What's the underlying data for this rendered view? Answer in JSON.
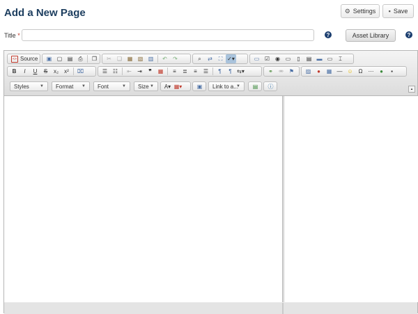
{
  "page": {
    "title": "Add a New Page"
  },
  "header": {
    "settings_label": "Settings",
    "save_label": "Save",
    "settings_icon": "gear-icon",
    "save_icon": "floppy-icon"
  },
  "title_field": {
    "label": "Title",
    "required_marker": "*",
    "value": "",
    "placeholder": ""
  },
  "help_glyph": "?",
  "asset_library_label": "Asset Library",
  "toolbar": {
    "source_label": "Source",
    "styles_label": "Styles",
    "format_label": "Format",
    "font_label": "Font",
    "size_label": "Size",
    "link_label": "Link to a..."
  },
  "colors": {
    "title": "#1c3d5e",
    "help_icon": "#1b3e6f",
    "active_tool": "#a9c3dc"
  }
}
